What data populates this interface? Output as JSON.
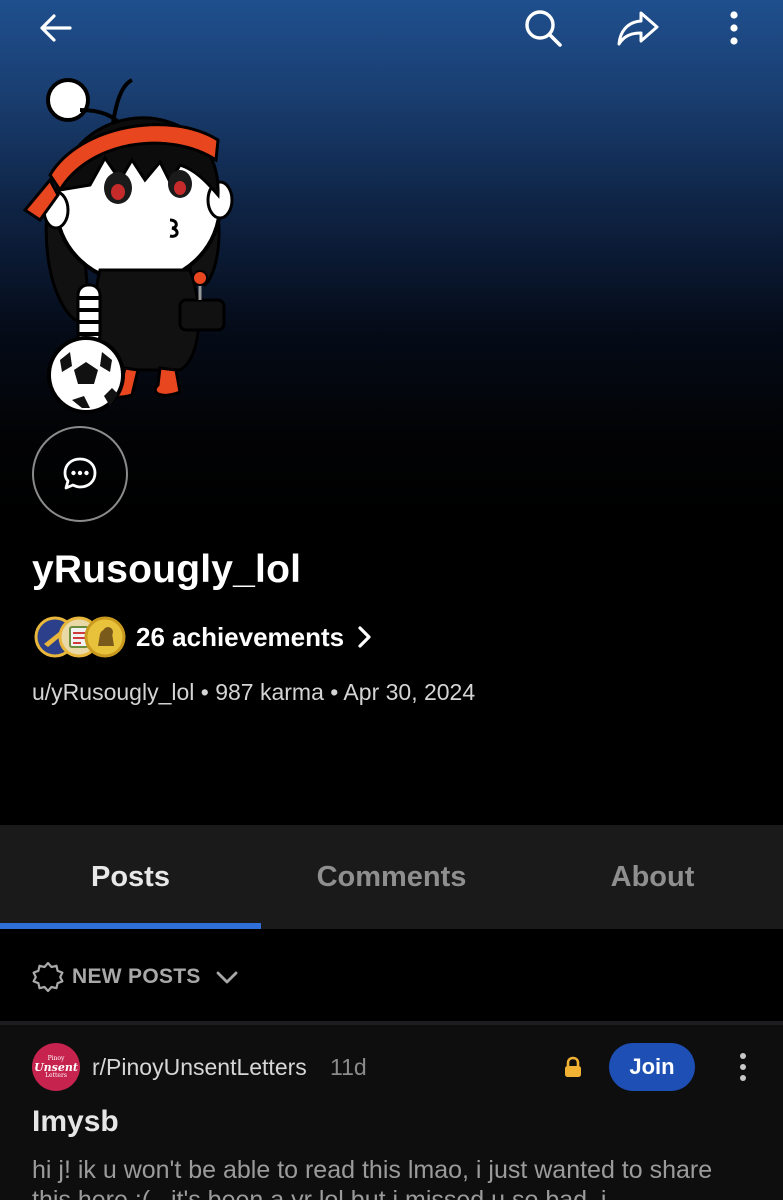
{
  "header": {
    "icons": {
      "back": "arrow-left-icon",
      "search": "search-icon",
      "share": "share-arrow-icon",
      "more": "vertical-dots-icon"
    }
  },
  "profile": {
    "username": "yRusougly_lol",
    "achievements_label": "26 achievements",
    "meta": "u/yRusougly_lol • 987 karma • Apr 30, 2024"
  },
  "tabs": [
    {
      "label": "Posts",
      "active": true
    },
    {
      "label": "Comments",
      "active": false
    },
    {
      "label": "About",
      "active": false
    }
  ],
  "sort": {
    "label": "NEW POSTS"
  },
  "post": {
    "subreddit": "r/PinoyUnsentLetters",
    "age": "11d",
    "join_label": "Join",
    "title": "Imysb",
    "body": "hi j! ik u won't be able to read this lmao, i just wanted to share this here :(.. it's been a yr lol but i missed u so bad. i",
    "subreddit_avatar": {
      "line1": "Pinoy",
      "line2": "Unsent",
      "line3": "Letters"
    }
  },
  "colors": {
    "accent_blue": "#2f6fd8",
    "join_blue": "#1d4fb5",
    "lock_yellow": "#f2b233",
    "subreddit_red": "#c7234f"
  }
}
